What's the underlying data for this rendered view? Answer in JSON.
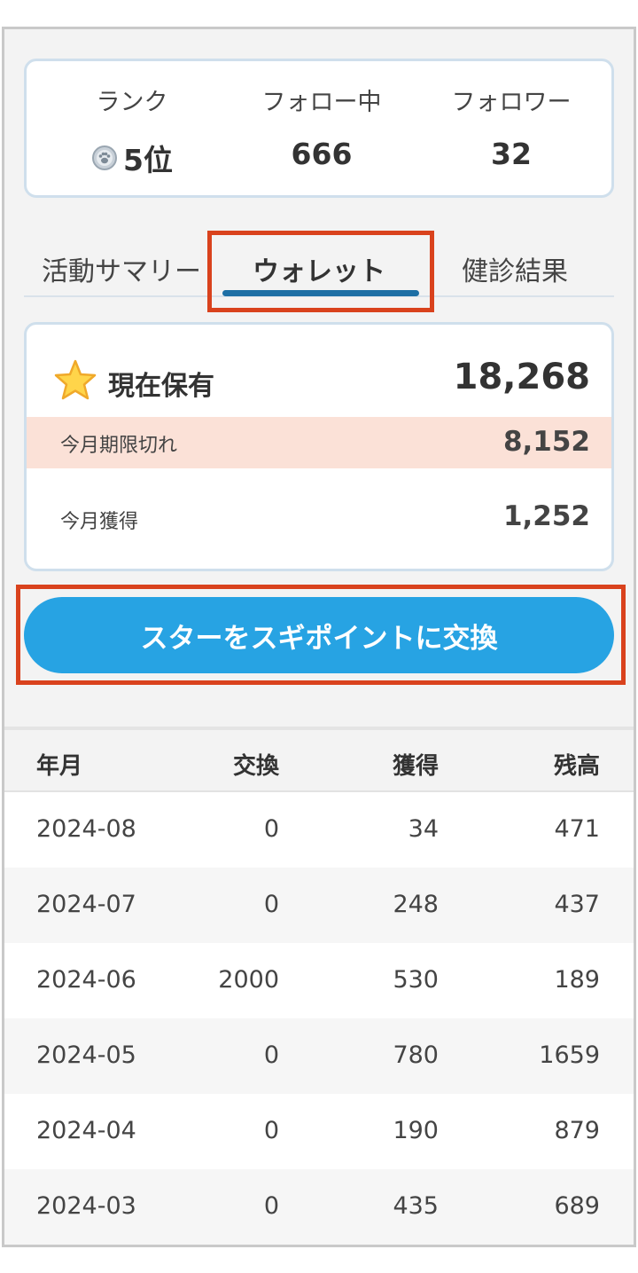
{
  "stats": {
    "rank": {
      "label": "ランク",
      "value": "5位"
    },
    "following": {
      "label": "フォロー中",
      "value": "666"
    },
    "followers": {
      "label": "フォロワー",
      "value": "32"
    }
  },
  "tabs": [
    {
      "label": "活動サマリー",
      "active": false
    },
    {
      "label": "ウォレット",
      "active": true
    },
    {
      "label": "健診結果",
      "active": false
    }
  ],
  "wallet": {
    "holding_label": "現在保有",
    "holding_value": "18,268",
    "expiring_label": "今月期限切れ",
    "expiring_value": "8,152",
    "earned_label": "今月獲得",
    "earned_value": "1,252"
  },
  "exchange_button": "スターをスギポイントに交換",
  "history": {
    "headers": {
      "month": "年月",
      "exchange": "交換",
      "earned": "獲得",
      "balance": "残高"
    },
    "rows": [
      {
        "month": "2024-08",
        "exchange": "0",
        "earned": "34",
        "balance": "471"
      },
      {
        "month": "2024-07",
        "exchange": "0",
        "earned": "248",
        "balance": "437"
      },
      {
        "month": "2024-06",
        "exchange": "2000",
        "earned": "530",
        "balance": "189"
      },
      {
        "month": "2024-05",
        "exchange": "0",
        "earned": "780",
        "balance": "1659"
      },
      {
        "month": "2024-04",
        "exchange": "0",
        "earned": "190",
        "balance": "879"
      },
      {
        "month": "2024-03",
        "exchange": "0",
        "earned": "435",
        "balance": "689"
      }
    ]
  },
  "colors": {
    "accent": "#27a3e3",
    "tab_underline": "#1d6fa5",
    "highlight": "#d9421d",
    "expire_bg": "#fbe1d7"
  }
}
